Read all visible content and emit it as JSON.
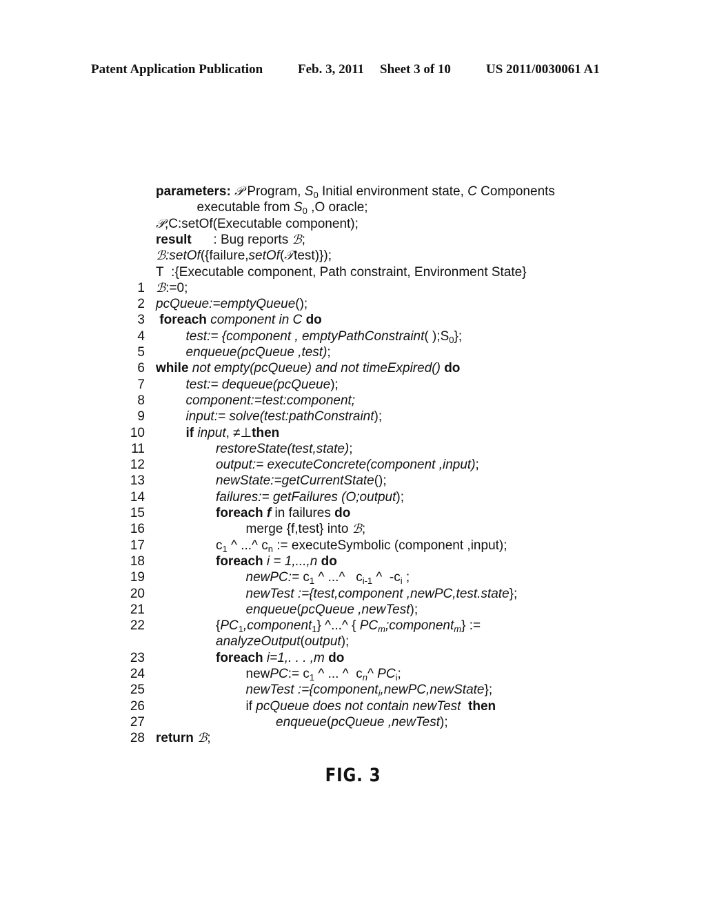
{
  "header": {
    "publication": "Patent Application Publication",
    "date": "Feb. 3, 2011",
    "sheet": "Sheet 3 of 10",
    "number": "US 2011/0030061 A1"
  },
  "figure_label": "FIG. 3",
  "preamble": [
    {
      "indent": 0,
      "segments": [
        {
          "k": "b",
          "t": "parameters: "
        },
        {
          "k": "script",
          "t": "𝒫"
        },
        {
          "k": "n",
          "t": " Program, "
        },
        {
          "k": "i",
          "t": "S"
        },
        {
          "k": "sub",
          "t": "0"
        },
        {
          "k": "n",
          "t": " Initial environment state, "
        },
        {
          "k": "i",
          "t": "C"
        },
        {
          "k": "n",
          "t": " Components"
        }
      ]
    },
    {
      "indent": 1,
      "segments": [
        {
          "k": "n",
          "t": "executable from "
        },
        {
          "k": "i",
          "t": "S"
        },
        {
          "k": "sub",
          "t": "0"
        },
        {
          "k": "n",
          "t": " ,O oracle;"
        }
      ]
    },
    {
      "indent": 0,
      "segments": [
        {
          "k": "script",
          "t": "𝒫"
        },
        {
          "k": "n",
          "t": ",C:setOf(Executable component);"
        }
      ]
    },
    {
      "indent": 0,
      "segments": [
        {
          "k": "b",
          "t": "result"
        },
        {
          "k": "n",
          "t": "      : Bug reports "
        },
        {
          "k": "script",
          "t": "ℬ"
        },
        {
          "k": "n",
          "t": ";"
        }
      ]
    },
    {
      "indent": 0,
      "segments": [
        {
          "k": "script",
          "t": "ℬ"
        },
        {
          "k": "i",
          "t": ":setOf"
        },
        {
          "k": "n",
          "t": "({failure,"
        },
        {
          "k": "i",
          "t": "setOf"
        },
        {
          "k": "n",
          "t": "("
        },
        {
          "k": "script",
          "t": "𝒯"
        },
        {
          "k": "n",
          "t": "test)});"
        }
      ]
    },
    {
      "indent": 0,
      "segments": [
        {
          "k": "n",
          "t": "T  :{Executable component, Path constraint, Environment State}"
        }
      ]
    }
  ],
  "lines": [
    {
      "num": "1",
      "indent": 0,
      "segments": [
        {
          "k": "script",
          "t": "ℬ"
        },
        {
          "k": "n",
          "t": ":=0;"
        }
      ]
    },
    {
      "num": "2",
      "indent": 0,
      "segments": [
        {
          "k": "i",
          "t": "pcQueue:=emptyQueue"
        },
        {
          "k": "n",
          "t": "();"
        }
      ]
    },
    {
      "num": "3",
      "indent": 0,
      "segments": [
        {
          "k": "b",
          "t": " foreach "
        },
        {
          "k": "i",
          "t": "component in C "
        },
        {
          "k": "b",
          "t": "do"
        }
      ]
    },
    {
      "num": "4",
      "indent": 1,
      "segments": [
        {
          "k": "i",
          "t": "test:= {component , emptyPathConstraint"
        },
        {
          "k": "n",
          "t": "( );S"
        },
        {
          "k": "sub",
          "t": "0"
        },
        {
          "k": "n",
          "t": "};"
        }
      ]
    },
    {
      "num": "5",
      "indent": 1,
      "segments": [
        {
          "k": "i",
          "t": "enqueue(pcQueue ,test)"
        },
        {
          "k": "n",
          "t": ";"
        }
      ]
    },
    {
      "num": "6",
      "indent": 0,
      "segments": [
        {
          "k": "b",
          "t": "while "
        },
        {
          "k": "i",
          "t": "not empty(pcQueue) and not timeExpired() "
        },
        {
          "k": "b",
          "t": "do"
        }
      ]
    },
    {
      "num": "7",
      "indent": 1,
      "segments": [
        {
          "k": "i",
          "t": "test:= dequeue(pcQueue"
        },
        {
          "k": "n",
          "t": ");"
        }
      ]
    },
    {
      "num": "8",
      "indent": 1,
      "segments": [
        {
          "k": "i",
          "t": "component:=test:component;"
        }
      ]
    },
    {
      "num": "9",
      "indent": 1,
      "segments": [
        {
          "k": "i",
          "t": "input:= solve(test:pathConstraint"
        },
        {
          "k": "n",
          "t": ");"
        }
      ]
    },
    {
      "num": "10",
      "indent": 1,
      "segments": [
        {
          "k": "b",
          "t": "if "
        },
        {
          "k": "i",
          "t": "input"
        },
        {
          "k": "n",
          "t": ", ≠⊥"
        },
        {
          "k": "b",
          "t": "then"
        }
      ]
    },
    {
      "num": "11",
      "indent": 2,
      "segments": [
        {
          "k": "i",
          "t": "restoreState(test,state)"
        },
        {
          "k": "n",
          "t": ";"
        }
      ]
    },
    {
      "num": "12",
      "indent": 2,
      "segments": [
        {
          "k": "i",
          "t": "output:= executeConcrete(component ,input)"
        },
        {
          "k": "n",
          "t": ";"
        }
      ]
    },
    {
      "num": "13",
      "indent": 2,
      "segments": [
        {
          "k": "i",
          "t": "newState:=getCurrentState"
        },
        {
          "k": "n",
          "t": "();"
        }
      ]
    },
    {
      "num": "14",
      "indent": 2,
      "segments": [
        {
          "k": "i",
          "t": "failures:= getFailures (O;output"
        },
        {
          "k": "n",
          "t": ");"
        }
      ]
    },
    {
      "num": "15",
      "indent": 2,
      "segments": [
        {
          "k": "b",
          "t": "foreach "
        },
        {
          "k": "bi",
          "t": "f"
        },
        {
          "k": "n",
          "t": " in failures "
        },
        {
          "k": "b",
          "t": "do"
        }
      ]
    },
    {
      "num": "16",
      "indent": 3,
      "segments": [
        {
          "k": "n",
          "t": "merge {f,test} into "
        },
        {
          "k": "script",
          "t": "ℬ"
        },
        {
          "k": "n",
          "t": ";"
        }
      ]
    },
    {
      "num": "17",
      "indent": 2,
      "segments": [
        {
          "k": "n",
          "t": "c"
        },
        {
          "k": "sub",
          "t": "1"
        },
        {
          "k": "n",
          "t": " ^ ...^ c"
        },
        {
          "k": "sub",
          "t": "n"
        },
        {
          "k": "n",
          "t": " := executeSymbolic (component ,input);"
        }
      ]
    },
    {
      "num": "18",
      "indent": 2,
      "segments": [
        {
          "k": "b",
          "t": "foreach "
        },
        {
          "k": "i",
          "t": "i = 1,...,n "
        },
        {
          "k": "b",
          "t": "do"
        }
      ]
    },
    {
      "num": "19",
      "indent": 3,
      "segments": [
        {
          "k": "i",
          "t": "newPC:= "
        },
        {
          "k": "n",
          "t": "c"
        },
        {
          "k": "sub",
          "t": "1"
        },
        {
          "k": "n",
          "t": " ^ ...^   c"
        },
        {
          "k": "sub",
          "t": "i-1"
        },
        {
          "k": "n",
          "t": " ^  -c"
        },
        {
          "k": "sub",
          "t": "i"
        },
        {
          "k": "n",
          "t": " ;"
        }
      ]
    },
    {
      "num": "20",
      "indent": 3,
      "segments": [
        {
          "k": "i",
          "t": "newTest :={test,component ,newPC,test.state"
        },
        {
          "k": "n",
          "t": "};"
        }
      ]
    },
    {
      "num": "21",
      "indent": 3,
      "segments": [
        {
          "k": "i",
          "t": "enqueue"
        },
        {
          "k": "n",
          "t": "("
        },
        {
          "k": "i",
          "t": "pcQueue ,newTest"
        },
        {
          "k": "n",
          "t": ");"
        }
      ]
    },
    {
      "num": "22",
      "indent": 2,
      "segments": [
        {
          "k": "n",
          "t": "{"
        },
        {
          "k": "i",
          "t": "PC"
        },
        {
          "k": "sub",
          "t": "1"
        },
        {
          "k": "i",
          "t": ",component"
        },
        {
          "k": "sub",
          "t": "1"
        },
        {
          "k": "n",
          "t": "} ^...^ { "
        },
        {
          "k": "i",
          "t": "PC"
        },
        {
          "k": "subi",
          "t": "m"
        },
        {
          "k": "i",
          "t": ";component"
        },
        {
          "k": "subi",
          "t": "m"
        },
        {
          "k": "n",
          "t": "} :="
        }
      ]
    },
    {
      "num": "",
      "indent": 2,
      "segments": [
        {
          "k": "i",
          "t": "analyzeOutput"
        },
        {
          "k": "n",
          "t": "("
        },
        {
          "k": "i",
          "t": "output"
        },
        {
          "k": "n",
          "t": ");"
        }
      ]
    },
    {
      "num": "23",
      "indent": 2,
      "segments": [
        {
          "k": "b",
          "t": "foreach "
        },
        {
          "k": "i",
          "t": "i=1,. . . ,m "
        },
        {
          "k": "b",
          "t": "do"
        }
      ]
    },
    {
      "num": "24",
      "indent": 3,
      "segments": [
        {
          "k": "n",
          "t": "new"
        },
        {
          "k": "i",
          "t": "PC"
        },
        {
          "k": "n",
          "t": ":= c"
        },
        {
          "k": "sub",
          "t": "1"
        },
        {
          "k": "n",
          "t": " ^ ... ^  c"
        },
        {
          "k": "subi",
          "t": "n"
        },
        {
          "k": "n",
          "t": "^ "
        },
        {
          "k": "i",
          "t": "PC"
        },
        {
          "k": "sub",
          "t": "i"
        },
        {
          "k": "n",
          "t": ";"
        }
      ]
    },
    {
      "num": "25",
      "indent": 3,
      "segments": [
        {
          "k": "i",
          "t": "newTest :={component"
        },
        {
          "k": "subi",
          "t": "i"
        },
        {
          "k": "i",
          "t": ",newPC,newState"
        },
        {
          "k": "n",
          "t": "};"
        }
      ]
    },
    {
      "num": "26",
      "indent": 3,
      "segments": [
        {
          "k": "n",
          "t": "if "
        },
        {
          "k": "i",
          "t": "pcQueue does not contain newTest  "
        },
        {
          "k": "b",
          "t": "then"
        }
      ]
    },
    {
      "num": "27",
      "indent": 4,
      "segments": [
        {
          "k": "i",
          "t": "enqueue"
        },
        {
          "k": "n",
          "t": "("
        },
        {
          "k": "i",
          "t": "pcQueue ,newTest"
        },
        {
          "k": "n",
          "t": ");"
        }
      ]
    },
    {
      "num": "28",
      "indent": 0,
      "segments": [
        {
          "k": "b",
          "t": "return "
        },
        {
          "k": "script",
          "t": "ℬ"
        },
        {
          "k": "n",
          "t": ";"
        }
      ]
    }
  ]
}
